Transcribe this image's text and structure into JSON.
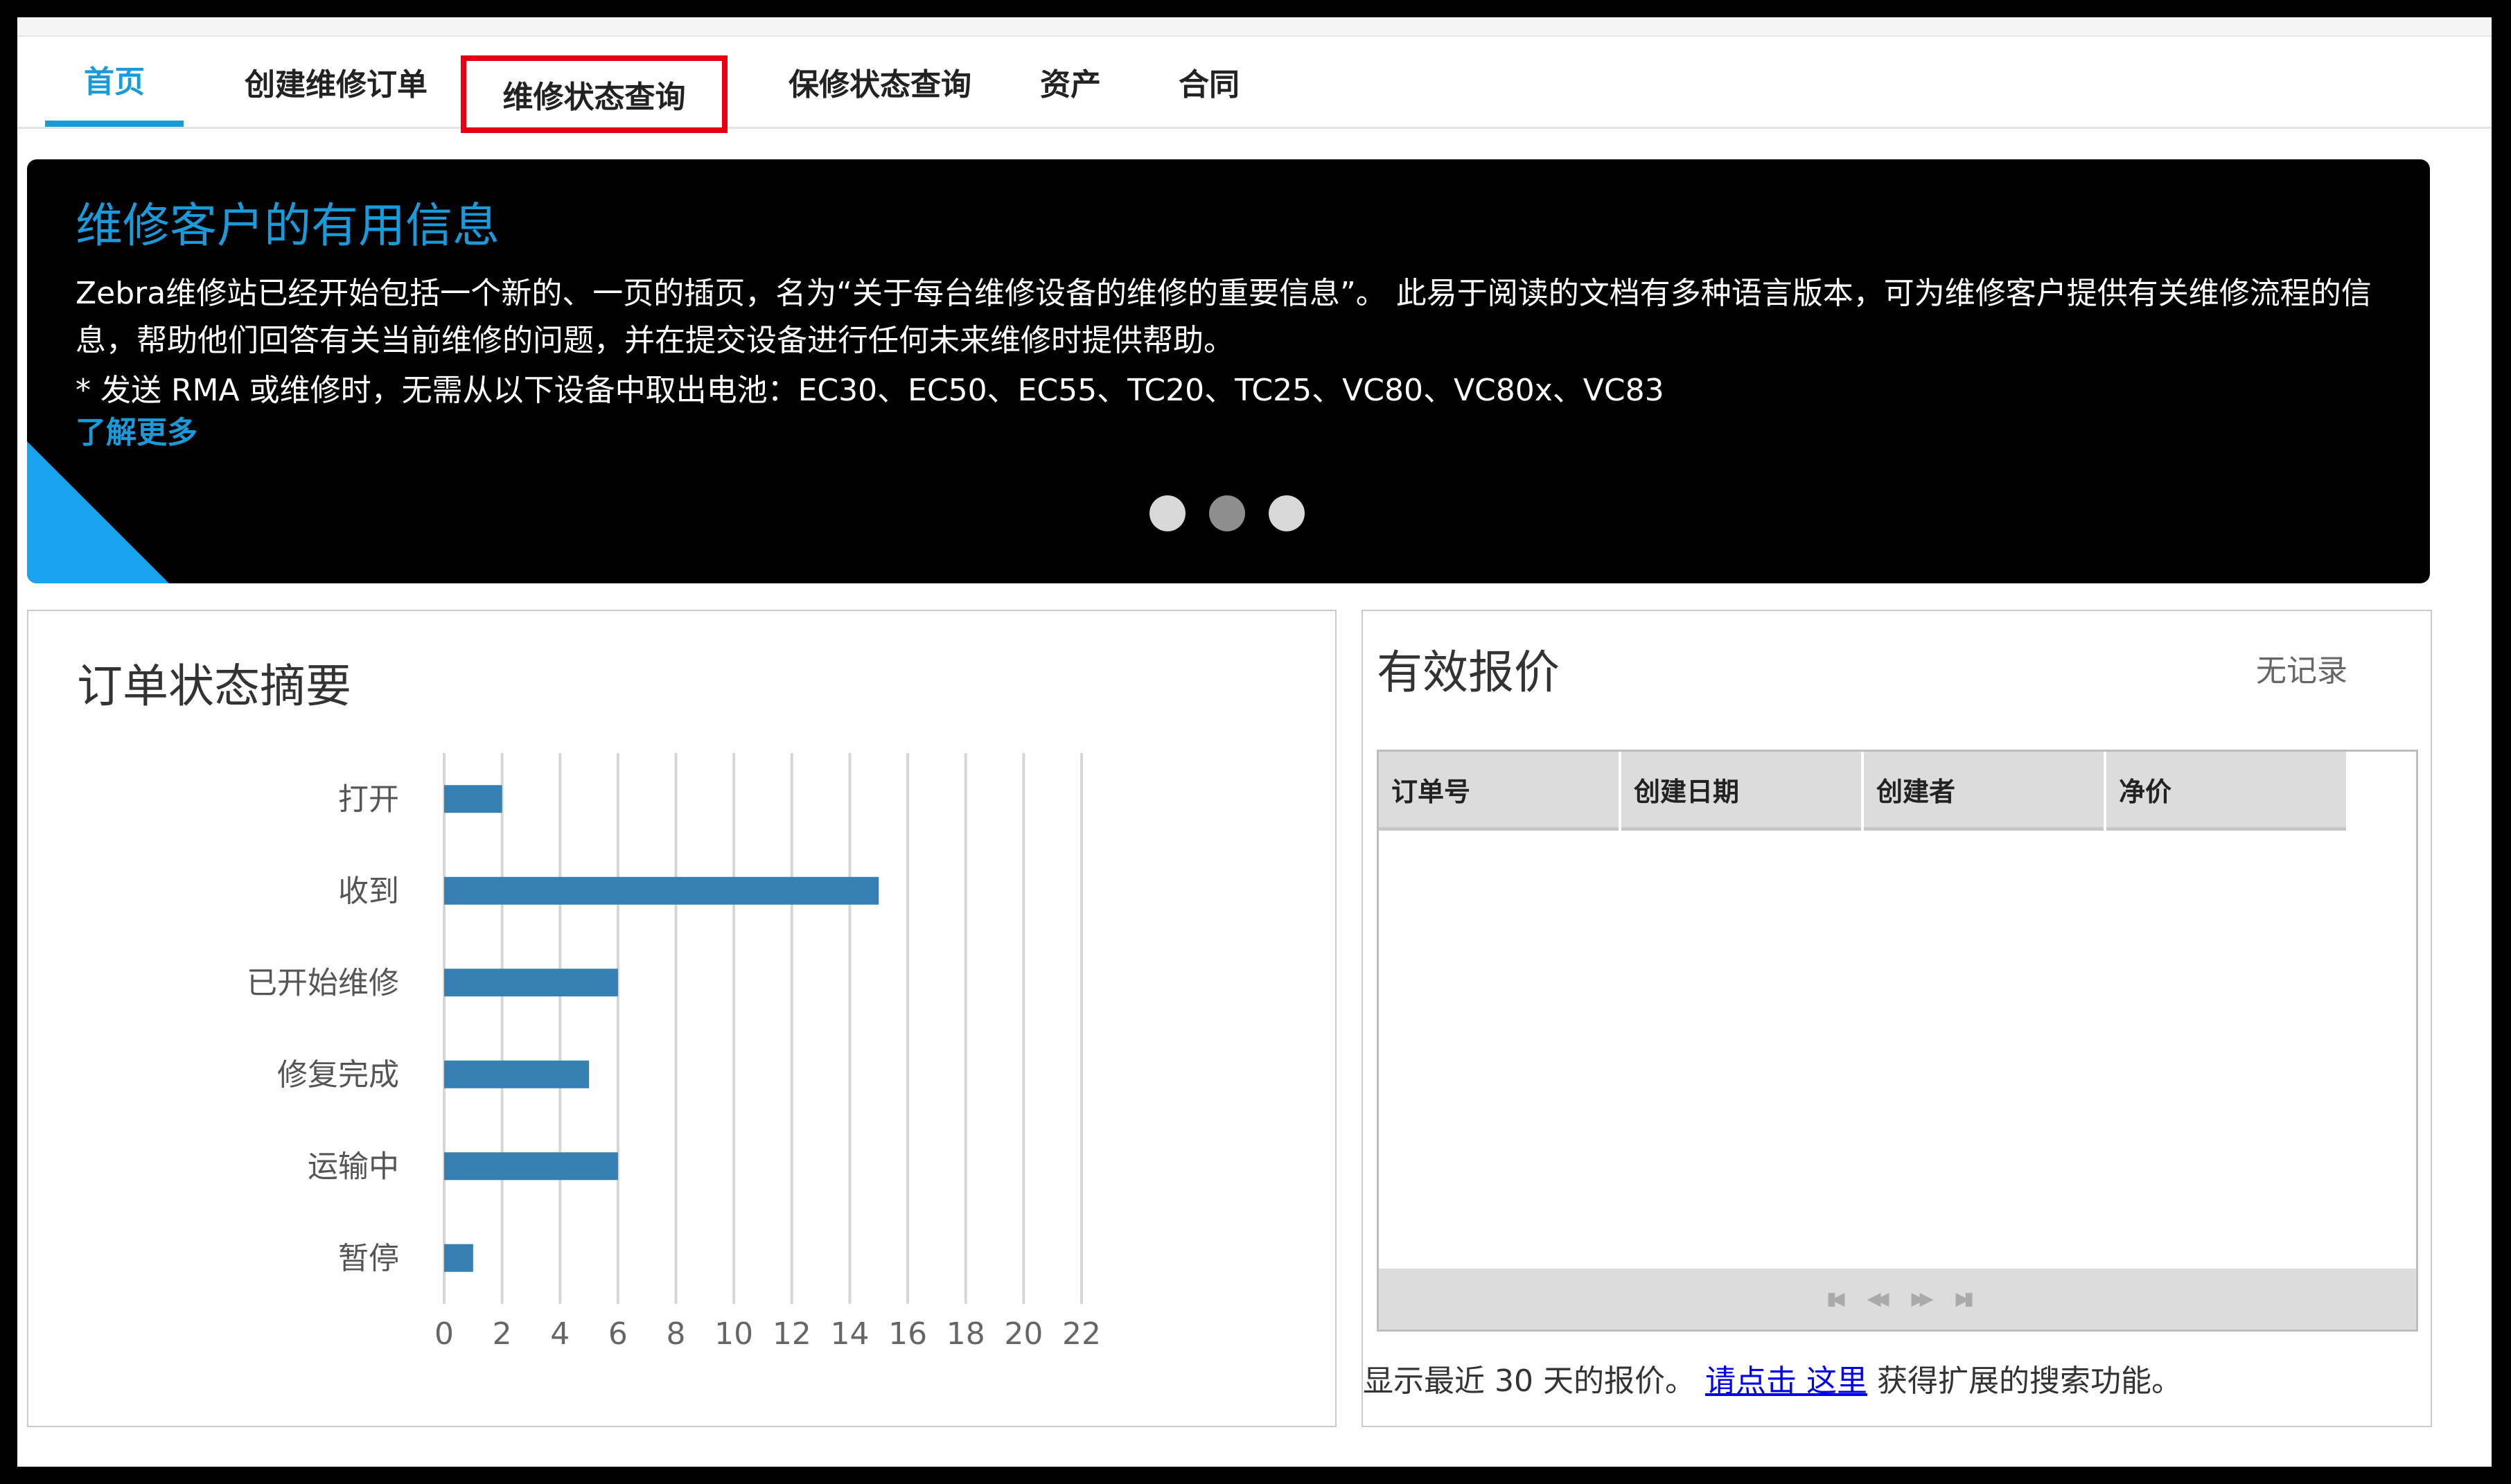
{
  "tabs": [
    {
      "label": "首页"
    },
    {
      "label": "创建维修订单"
    },
    {
      "label": "维修状态查询"
    },
    {
      "label": "保修状态查询"
    },
    {
      "label": "资产"
    },
    {
      "label": "合同"
    }
  ],
  "banner": {
    "title": "维修客户的有用信息",
    "text": "Zebra维修站已经开始包括一个新的、一页的插页，名为“关于每台维修设备的维修的重要信息”。 此易于阅读的文档有多种语言版本，可为维修客户提供有关维修流程的信息，帮助他们回答有关当前维修的问题，并在提交设备进行任何未来维修时提供帮助。",
    "note": "* 发送 RMA 或维修时，无需从以下设备中取出电池：EC30、EC50、EC55、TC20、TC25、VC80、VC80x、VC83",
    "link": "了解更多",
    "slide_count": 3,
    "active_slide": 2
  },
  "summary": {
    "title": "订单状态摘要"
  },
  "chart_data": {
    "type": "bar",
    "orientation": "horizontal",
    "categories": [
      "打开",
      "收到",
      "已开始维修",
      "修复完成",
      "运输中",
      "暂停"
    ],
    "values": [
      2,
      15,
      6,
      5,
      6,
      1
    ],
    "xlim": [
      0,
      22
    ],
    "xticks": [
      "0",
      "2",
      "4",
      "6",
      "8",
      "10",
      "12",
      "14",
      "16",
      "18",
      "20",
      "22"
    ],
    "grid": true,
    "bar_color": "#357fb2"
  },
  "quotes": {
    "title": "有效报价",
    "no_record": "无记录",
    "columns": [
      "订单号",
      "创建日期",
      "创建者",
      "净价"
    ],
    "footer_prefix": "显示最近 30 天的报价。 ",
    "footer_link": "请点击 这里",
    "footer_suffix": " 获得扩展的搜索功能。"
  },
  "colors": {
    "accent": "#1a9ad9",
    "highlight_border": "#e60012",
    "bar": "#357fb2"
  }
}
